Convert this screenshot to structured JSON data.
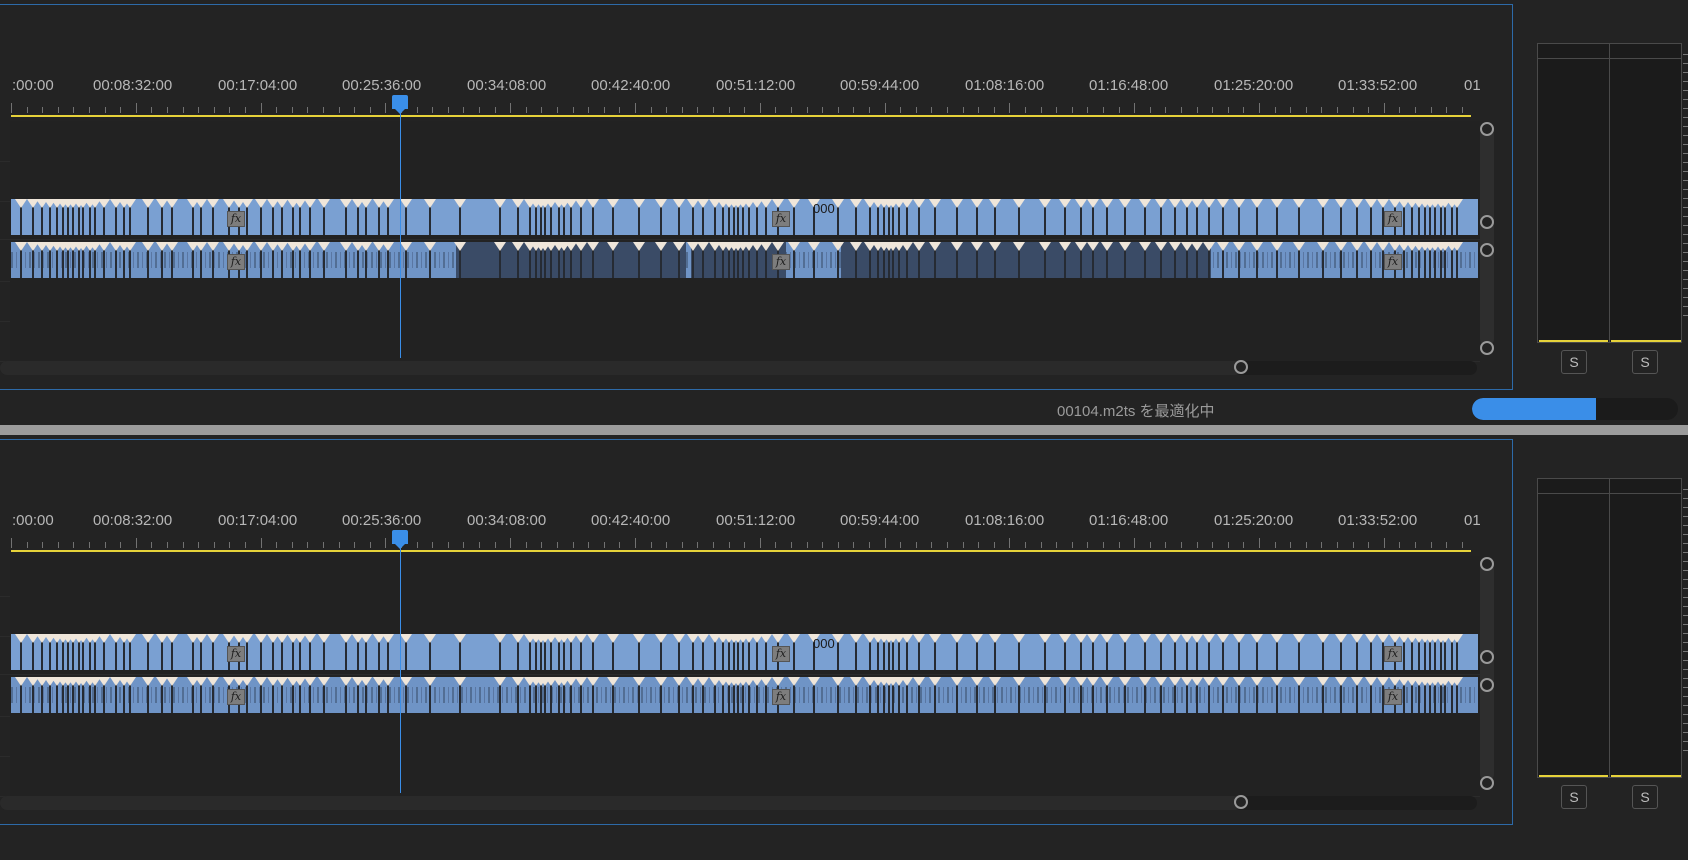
{
  "ruler_labels": [
    ":00:00",
    "00:08:32:00",
    "00:17:04:00",
    "00:25:36:00",
    "00:34:08:00",
    "00:42:40:00",
    "00:51:12:00",
    "00:59:44:00",
    "01:08:16:00",
    "01:16:48:00",
    "01:25:20:00",
    "01:33:52:00",
    "01"
  ],
  "clip_name": "000",
  "fx_label": "fx",
  "solo_left": "S",
  "solo_right": "S",
  "status": {
    "message": "00104.m2ts を最適化中",
    "progress_fraction": 0.6
  },
  "colors": {
    "accent": "#3a8ee8",
    "clip_video": "#7aa0d2",
    "clip_audio": "#6f94c6",
    "ruler_line": "#e6d23a"
  },
  "icons": [
    "playhead-icon",
    "fx-badge-icon",
    "scroll-knob-icon"
  ]
}
